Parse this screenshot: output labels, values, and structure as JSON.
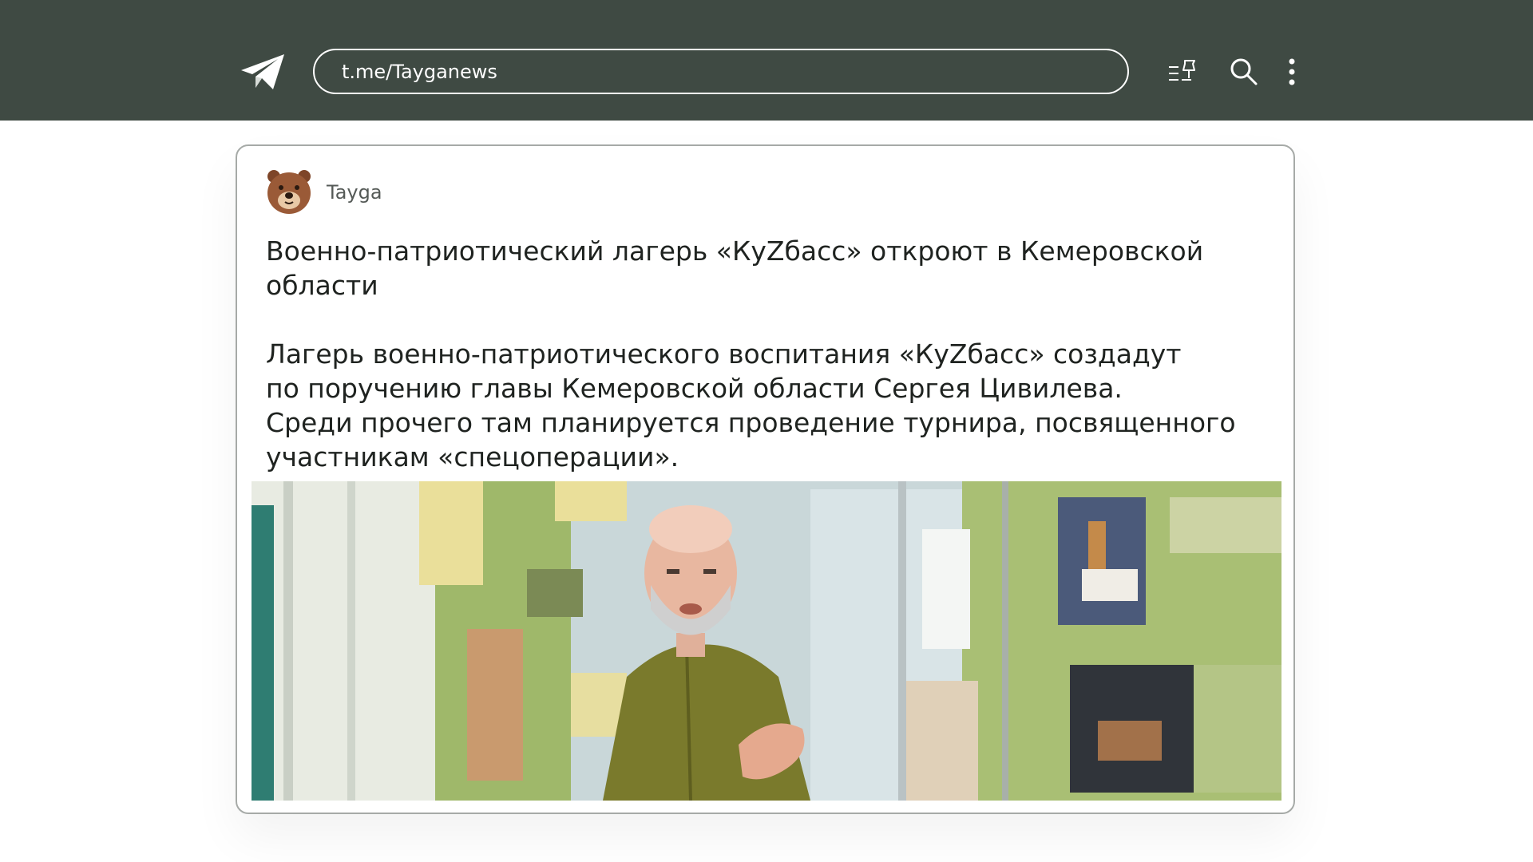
{
  "header": {
    "url": "t.me/Tayganews",
    "icons": [
      "telegram-logo-icon",
      "pinned-list-icon",
      "search-icon",
      "more-vertical-icon"
    ]
  },
  "post": {
    "channel_name": "Tayga",
    "title": "Военно-патриотический лагерь «КуZбасс» откроют в Кемеровской области",
    "body_lines": [
      "Лагерь военно-патриотического воспитания «КуZбасс» создадут",
      "по поручению главы Кемеровской области Сергея Цивилева.",
      "Среди прочего там планируется проведение турнира, посвященного",
      "участникам «спецоперации»."
    ]
  },
  "colors": {
    "header_bg": "#3f4a43",
    "card_border": "#a6aaa7",
    "text": "#1f2320",
    "avatar_brown": "#9a5a37"
  }
}
